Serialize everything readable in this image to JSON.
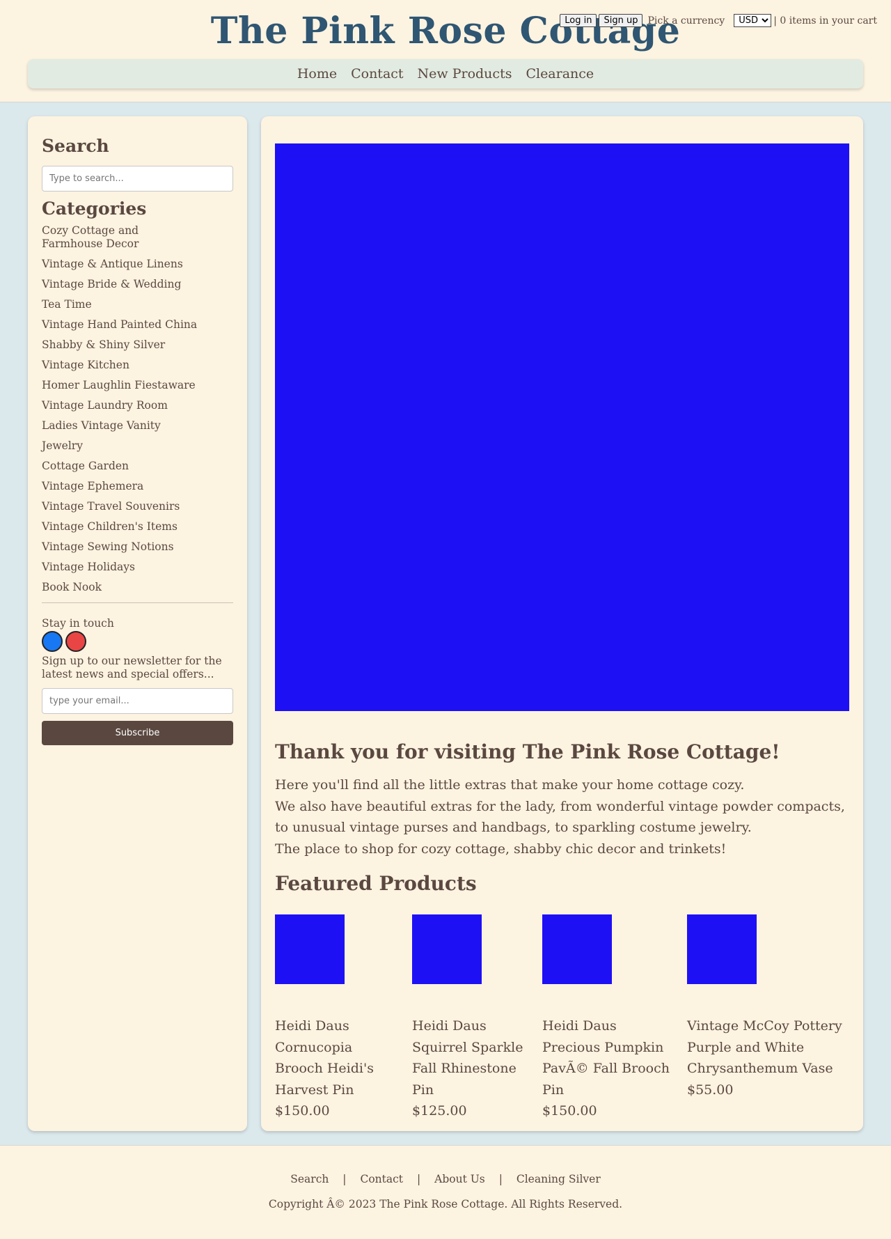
{
  "header": {
    "site_title": "The Pink Rose Cottage",
    "login_label": "Log in",
    "signup_label": "Sign up",
    "currency_label": "Pick a currency",
    "currency_selected": "USD",
    "cart_text": "| 0 items in your cart"
  },
  "nav": {
    "items": [
      {
        "label": "Home"
      },
      {
        "label": "Contact"
      },
      {
        "label": "New Products"
      },
      {
        "label": "Clearance"
      }
    ]
  },
  "sidebar": {
    "search_title": "Search",
    "search_placeholder": "Type to search...",
    "categories_title": "Categories",
    "categories": [
      "Cozy Cottage and Farmhouse Decor",
      "Vintage & Antique Linens",
      "Vintage Bride & Wedding",
      "Tea Time",
      "Vintage Hand Painted China",
      "Shabby & Shiny Silver",
      "Vintage Kitchen",
      "Homer Laughlin Fiestaware",
      "Vintage Laundry Room",
      "Ladies Vintage Vanity",
      "Jewelry",
      "Cottage Garden",
      "Vintage Ephemera",
      "Vintage Travel Souvenirs",
      "Vintage Children's Items",
      "Vintage Sewing Notions",
      "Vintage Holidays",
      "Book Nook"
    ],
    "stay_in_touch": "Stay in touch",
    "social": [
      {
        "icon": "facebook-icon",
        "color": "#1877f2"
      },
      {
        "icon": "pinterest-icon",
        "color": "#e94545"
      }
    ],
    "newsletter_text": "Sign up to our newsletter for the latest news and special offers...",
    "email_placeholder": "type your email...",
    "subscribe_label": "Subscribe"
  },
  "main": {
    "hero_color": "#1e10f5",
    "welcome_title": "Thank you for visiting The Pink Rose Cottage!",
    "welcome_lines": [
      "Here you'll find all the little extras that make your home cottage cozy.",
      "We also have beautiful extras for the lady, from wonderful vintage powder compacts, to unusual vintage purses and handbags, to sparkling costume jewelry.",
      "The place to shop for cozy cottage, shabby chic decor and trinkets!"
    ],
    "featured_title": "Featured Products",
    "products": [
      {
        "name": "Heidi Daus Cornucopia Brooch Heidi's Harvest Pin",
        "price": "$150.00"
      },
      {
        "name": "Heidi Daus Squirrel Sparkle Fall Rhinestone Pin",
        "price": "$125.00"
      },
      {
        "name": "Heidi Daus Precious Pumpkin PavÃ© Fall Brooch Pin",
        "price": "$150.00"
      },
      {
        "name": "Vintage McCoy Pottery Purple and White Chrysanthemum Vase",
        "price": "$55.00"
      }
    ]
  },
  "footer": {
    "links": [
      "Search",
      "Contact",
      "About Us",
      "Cleaning Silver"
    ],
    "separator": "|",
    "copyright": "Copyright Â© 2023 The Pink Rose Cottage. All Rights Reserved."
  },
  "colors": {
    "background": "#dbe8ec",
    "panel": "#fdf3e1",
    "title": "#2f5672",
    "text": "#5a4840",
    "nav_bg": "#e2ebe1",
    "placeholder_image": "#1e10f5"
  }
}
